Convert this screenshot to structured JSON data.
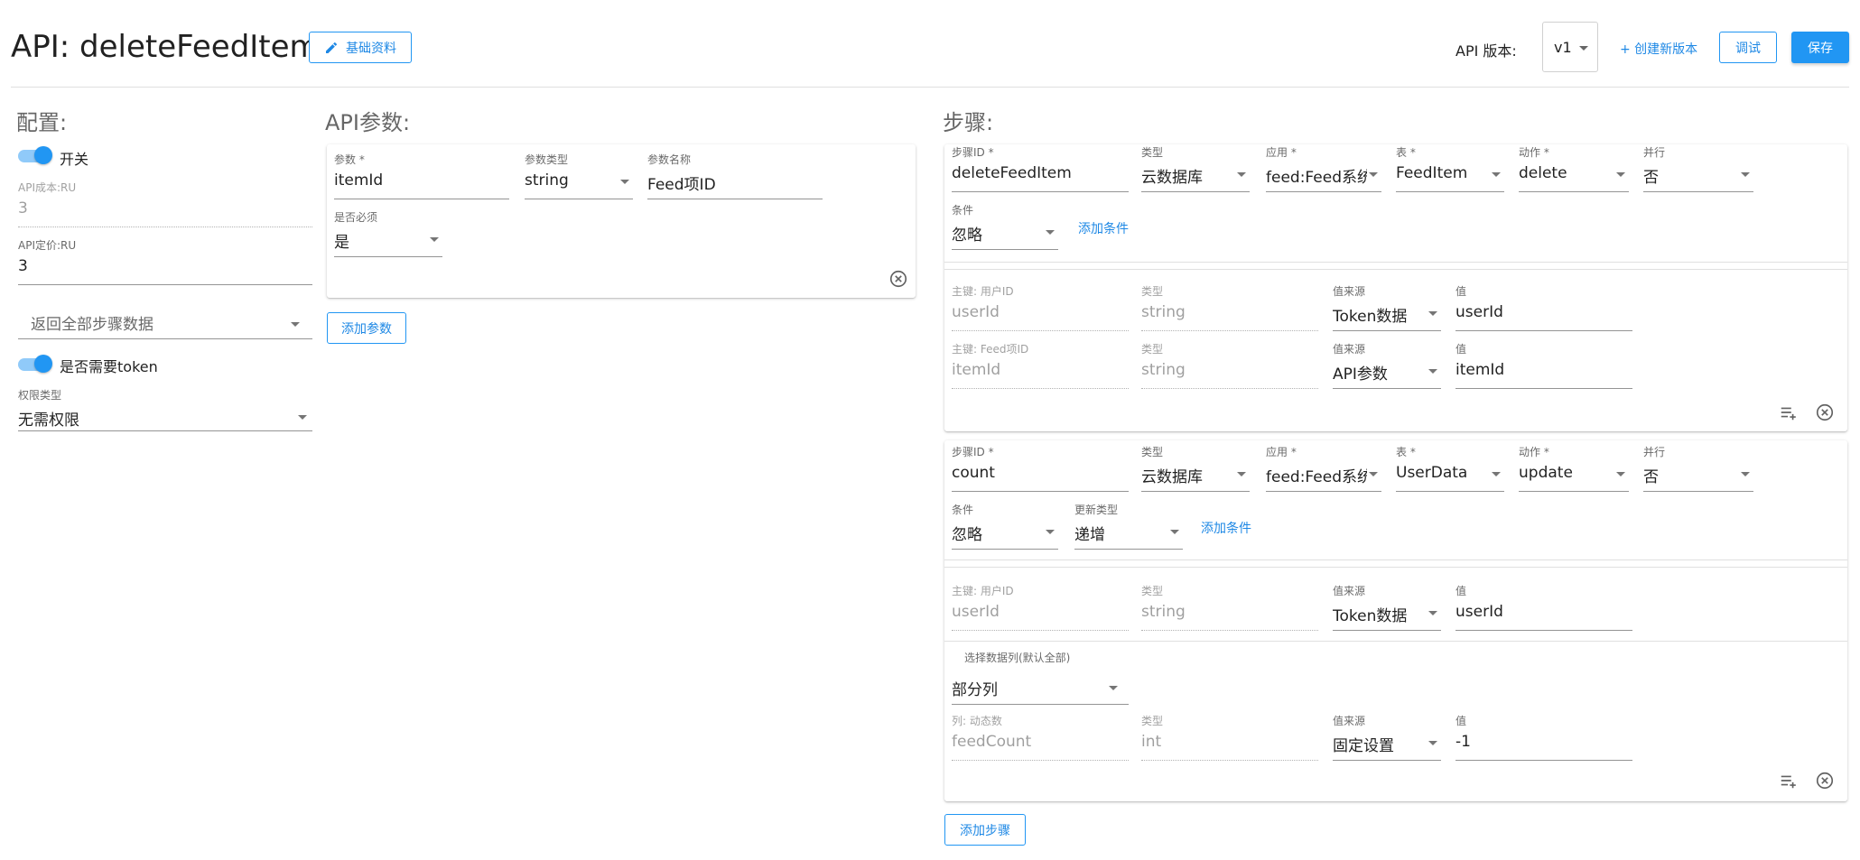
{
  "header": {
    "title": "API: deleteFeedItem",
    "basic_info_label": "基础资料",
    "version_label": "API 版本:",
    "version_value": "v1",
    "create_version_label": "+ 创建新版本",
    "debug_label": "调试",
    "save_label": "保存"
  },
  "config": {
    "title": "配置:",
    "switch_label": "开关",
    "cost_label": "API成本:RU",
    "cost_value": "3",
    "price_label": "API定价:RU",
    "price_value": "3",
    "return_select": "返回全部步骤数据",
    "token_label": "是否需要token",
    "perm_label": "权限类型",
    "perm_value": "无需权限"
  },
  "params": {
    "title": "API参数:",
    "param_label": "参数 *",
    "param_value": "itemId",
    "type_label": "参数类型",
    "type_value": "string",
    "name_label": "参数名称",
    "name_value": "Feed项ID",
    "required_label": "是否必须",
    "required_value": "是",
    "add_label": "添加参数"
  },
  "steps": {
    "title": "步骤:",
    "add_step_label": "添加步骤",
    "list": [
      {
        "id_label": "步骤ID *",
        "id_value": "deleteFeedItem",
        "type_label": "类型",
        "type_value": "云数据库",
        "app_label": "应用 *",
        "app_value": "feed:Feed系统",
        "table_label": "表 *",
        "table_value": "FeedItem",
        "action_label": "动作 *",
        "action_value": "delete",
        "parallel_label": "并行",
        "parallel_value": "否",
        "cond_label": "条件",
        "cond_value": "忽略",
        "add_cond_label": "添加条件",
        "keys": [
          {
            "key_label": "主键: 用户ID",
            "key_value": "userId",
            "ktype_label": "类型",
            "ktype_value": "string",
            "src_label": "值来源",
            "src_value": "Token数据",
            "val_label": "值",
            "val_value": "userId"
          },
          {
            "key_label": "主键: Feed项ID",
            "key_value": "itemId",
            "ktype_label": "类型",
            "ktype_value": "string",
            "src_label": "值来源",
            "src_value": "API参数",
            "val_label": "值",
            "val_value": "itemId"
          }
        ]
      },
      {
        "id_label": "步骤ID *",
        "id_value": "count",
        "type_label": "类型",
        "type_value": "云数据库",
        "app_label": "应用 *",
        "app_value": "feed:Feed系统",
        "table_label": "表 *",
        "table_value": "UserData",
        "action_label": "动作 *",
        "action_value": "update",
        "parallel_label": "并行",
        "parallel_value": "否",
        "cond_label": "条件",
        "cond_value": "忽略",
        "update_type_label": "更新类型",
        "update_type_value": "递增",
        "add_cond_label": "添加条件",
        "keys": [
          {
            "key_label": "主键: 用户ID",
            "key_value": "userId",
            "ktype_label": "类型",
            "ktype_value": "string",
            "src_label": "值来源",
            "src_value": "Token数据",
            "val_label": "值",
            "val_value": "userId"
          }
        ],
        "cols_label": "选择数据列(默认全部)",
        "cols_value": "部分列",
        "cols": [
          {
            "key_label": "列: 动态数",
            "key_value": "feedCount",
            "ktype_label": "类型",
            "ktype_value": "int",
            "src_label": "值来源",
            "src_value": "固定设置",
            "val_label": "值",
            "val_value": "-1"
          }
        ]
      }
    ]
  },
  "colors": {
    "primary": "#2196f3",
    "primary_light": "#90caf9"
  }
}
